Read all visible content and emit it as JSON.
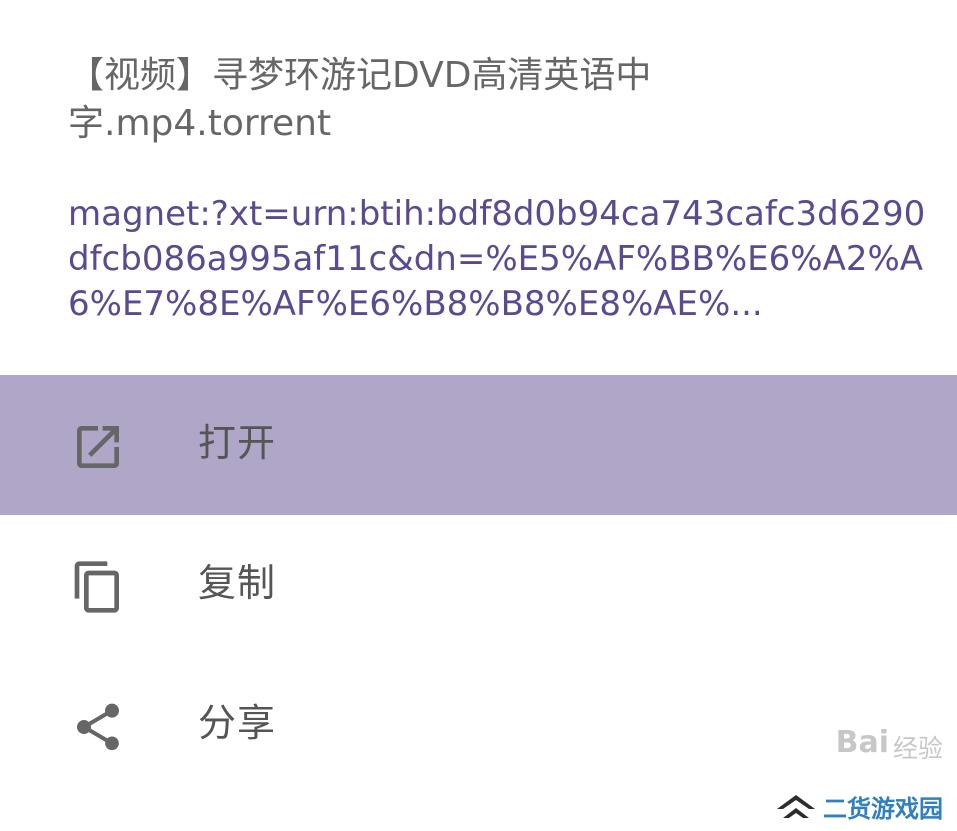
{
  "share_sheet": {
    "file_title": "【视频】寻梦环游记DVD高清英语中\n字.mp4.torrent",
    "magnet_link": "magnet:?xt=urn:btih:bdf8d0b94ca743cafc3d6290dfcb086a995af11c&dn=%E5%AF%BB%E6%A2%A6%E7%8E%AF%E6%B8%B8%E8%AE%...",
    "menu_items": [
      {
        "label": "打开",
        "icon": "open-in-new-icon",
        "highlighted": true
      },
      {
        "label": "复制",
        "icon": "copy-icon",
        "highlighted": false
      },
      {
        "label": "分享",
        "icon": "share-icon",
        "highlighted": false
      }
    ]
  },
  "watermark": {
    "baidu": "Bai",
    "jingyan": "经验",
    "brand": "二货游戏园"
  },
  "colors": {
    "highlight_bg": "#afa6c8",
    "link": "#5b4a90",
    "text": "#666666",
    "icon": "#666666",
    "watermark_brand": "#2f7fc1"
  }
}
